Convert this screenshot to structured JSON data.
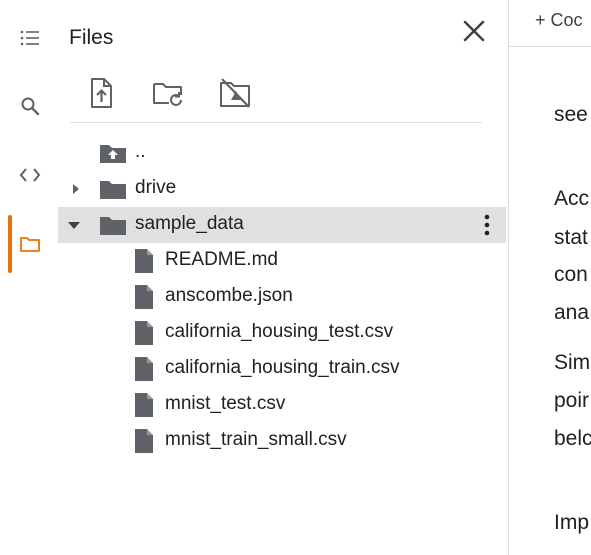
{
  "rail": {
    "items": [
      {
        "name": "table-of-contents-icon"
      },
      {
        "name": "search-icon"
      },
      {
        "name": "code-snippets-icon"
      },
      {
        "name": "folder-icon",
        "active": true
      }
    ],
    "active_color": "#e8710a"
  },
  "panel": {
    "title": "Files",
    "toolbar": [
      {
        "name": "upload-file-icon"
      },
      {
        "name": "refresh-folder-icon"
      },
      {
        "name": "unmount-drive-icon"
      }
    ]
  },
  "tree": [
    {
      "label": "..",
      "type": "parent"
    },
    {
      "label": "drive",
      "type": "folder",
      "expanded": false
    },
    {
      "label": "sample_data",
      "type": "folder",
      "expanded": true,
      "selected": true
    },
    {
      "label": "README.md",
      "type": "file"
    },
    {
      "label": "anscombe.json",
      "type": "file"
    },
    {
      "label": "california_housing_test.csv",
      "type": "file"
    },
    {
      "label": "california_housing_train.csv",
      "type": "file"
    },
    {
      "label": "mnist_test.csv",
      "type": "file"
    },
    {
      "label": "mnist_train_small.csv",
      "type": "file"
    }
  ],
  "notebook": {
    "add_label": "+ Coc",
    "lines": [
      "see",
      "Acc",
      "stat",
      "con",
      "ana",
      "Sim",
      "poir",
      "belc",
      "Imp"
    ]
  },
  "colors": {
    "icon": "#5f6368",
    "selected_row": "#e0e0e0",
    "text": "#202124"
  }
}
